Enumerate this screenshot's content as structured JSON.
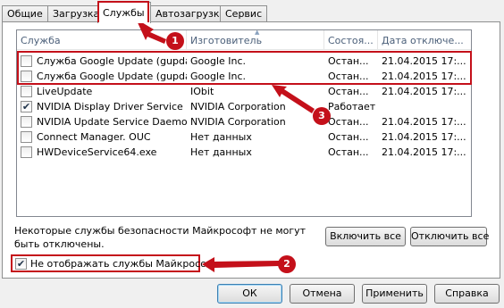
{
  "tabs": [
    "Общие",
    "Загрузка",
    "Службы",
    "Автозагрузка",
    "Сервис"
  ],
  "active_tab": "Службы",
  "columns": [
    "Служба",
    "Изготовитель",
    "Состоя...",
    "Дата отключе..."
  ],
  "services": [
    {
      "name": "Служба Google Update (gupdate)",
      "maker": "Google Inc.",
      "state": "Остан...",
      "date": "21.04.2015 17:...",
      "checked": false
    },
    {
      "name": "Служба Google Update (gupdat...",
      "maker": "Google Inc.",
      "state": "Остан...",
      "date": "21.04.2015 17:...",
      "checked": false
    },
    {
      "name": "LiveUpdate",
      "maker": "IObit",
      "state": "Остан...",
      "date": "21.04.2015 17:...",
      "checked": false
    },
    {
      "name": "NVIDIA Display Driver Service",
      "maker": "NVIDIA Corporation",
      "state": "Работает",
      "date": "",
      "checked": true
    },
    {
      "name": "NVIDIA Update Service Daemon",
      "maker": "NVIDIA Corporation",
      "state": "Остан...",
      "date": "21.04.2015 17:...",
      "checked": false
    },
    {
      "name": "Connect Manager. OUC",
      "maker": "Нет данных",
      "state": "Остан...",
      "date": "21.04.2015 17:...",
      "checked": false
    },
    {
      "name": "HWDeviceService64.exe",
      "maker": "Нет данных",
      "state": "Остан...",
      "date": "21.04.2015 17:...",
      "checked": false
    }
  ],
  "note": "Некоторые службы безопасности Майкрософт не могут быть отключены.",
  "buttons": {
    "enable_all": "Включить все",
    "disable_all": "Отключить все",
    "ok": "ОК",
    "cancel": "Отмена",
    "apply": "Применить",
    "help": "Справка"
  },
  "hide_ms": {
    "label": "Не отображать службы Майкрософт",
    "checked": true
  },
  "callouts": [
    "1",
    "2",
    "3"
  ],
  "colors": {
    "highlight": "#c4101a",
    "header_text": "#4c607a"
  }
}
